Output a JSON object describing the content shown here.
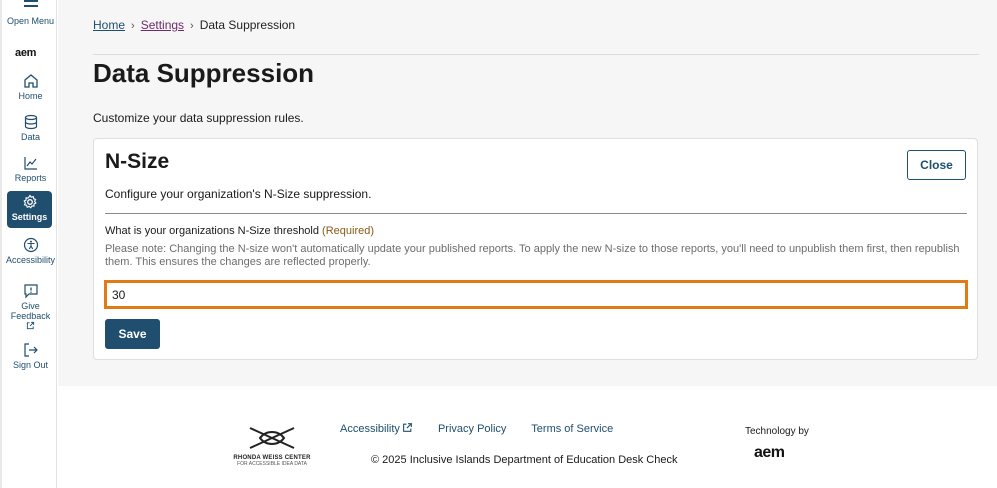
{
  "sidebar": {
    "open_menu": "Open Menu",
    "logo": "aem",
    "items": [
      {
        "label": "Home",
        "icon": "home-icon"
      },
      {
        "label": "Data",
        "icon": "database-icon"
      },
      {
        "label": "Reports",
        "icon": "chart-icon"
      },
      {
        "label": "Settings",
        "icon": "gear-icon"
      },
      {
        "label": "Accessibility",
        "icon": "accessibility-icon"
      },
      {
        "label": "Give Feedback",
        "icon": "feedback-icon"
      },
      {
        "label": "Sign Out",
        "icon": "sign-out-icon"
      }
    ]
  },
  "breadcrumb": {
    "home": "Home",
    "settings": "Settings",
    "current": "Data Suppression"
  },
  "page": {
    "title": "Data Suppression",
    "description": "Customize your data suppression rules."
  },
  "card": {
    "title": "N-Size",
    "close_label": "Close",
    "description": "Configure your organization's N-Size suppression.",
    "field_label": "What is your organizations N-Size threshold",
    "required": "(Required)",
    "note": "Please note: Changing the N-size won't automatically update your published reports. To apply the new N-size to those reports, you'll need to unpublish them first, then republish them. This ensures the changes are reflected properly.",
    "input_value": "30",
    "save_label": "Save"
  },
  "footer": {
    "partner_logo_line1": "RHONDA WEISS CENTER",
    "partner_logo_line2": "FOR ACCESSIBLE IDEA DATA",
    "links": [
      "Accessibility",
      "Privacy Policy",
      "Terms of Service"
    ],
    "copyright": "© 2025 Inclusive Islands Department of Education Desk Check",
    "tech_by": "Technology by",
    "tech_logo": "aem"
  },
  "colors": {
    "primary": "#1f4e6e",
    "focus_outline": "#e07b16",
    "required_text": "#8a5a14"
  }
}
